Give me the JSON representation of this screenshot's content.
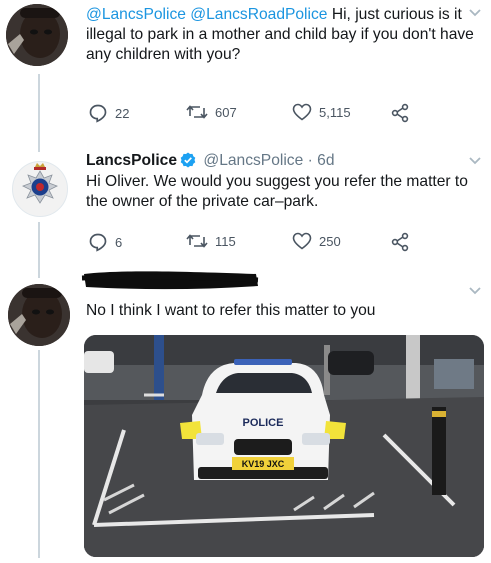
{
  "tweets": [
    {
      "mentions": [
        "@LancsPolice",
        "@LancsRoadPolice"
      ],
      "text": "Hi, just curious is it illegal to park in a mother and child bay if you don't have any children with you?",
      "replies": "22",
      "retweets": "607",
      "likes": "5,115"
    },
    {
      "name": "LancsPolice",
      "handle": "@LancsPolice",
      "time": "· 6d",
      "text": "Hi Oliver. We would you suggest you refer the matter to the owner of the private car–park.",
      "replies": "6",
      "retweets": "115",
      "likes": "250"
    },
    {
      "text": "No I think I want to refer this matter to you",
      "photo": {
        "car_livery": "POLICE",
        "plate": "KV19 JXC"
      }
    }
  ],
  "colors": {
    "link": "#1b95e0",
    "text": "#14171a",
    "muted": "#657786",
    "verified": "#1da1f2",
    "divider": "#ccd6dd"
  },
  "icons": [
    "chevron-down-icon",
    "reply-icon",
    "retweet-icon",
    "like-icon",
    "share-icon",
    "verified-badge-icon"
  ]
}
